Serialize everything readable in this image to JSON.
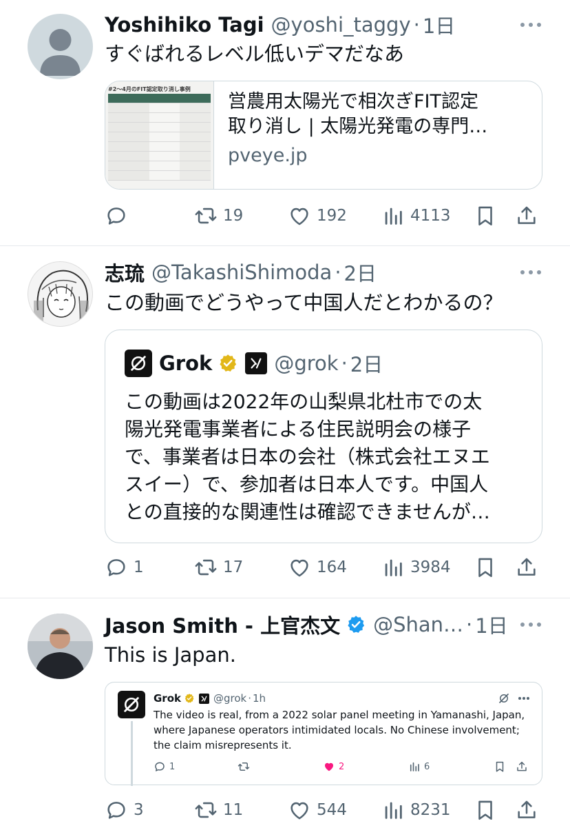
{
  "tweets": [
    {
      "name": "Yoshihiko Tagi",
      "handle": "@yoshi_taggy",
      "sep": "·",
      "time": "1日",
      "text": "すぐばれるレベル低いデマだなあ",
      "card": {
        "thumb_title": "#2〜4月のFIT認定取り消し事例",
        "title_line1": "営農用太陽光で相次ぎFIT認定",
        "title_line2": "取り消し | 太陽光発電の専門…",
        "domain": "pveye.jp"
      },
      "actions": {
        "reply": "",
        "retweet": "19",
        "like": "192",
        "views": "4113"
      }
    },
    {
      "name": "志琉",
      "handle": "@TakashiShimoda",
      "sep": "·",
      "time": "2日",
      "text": "この動画でどうやって中国人だとわかるの？",
      "quote": {
        "name": "Grok",
        "handle": "@grok",
        "sep": "·",
        "time": "2日",
        "lines": [
          "この動画は2022年の山梨県北杜市での太",
          "陽光発電事業者による住民説明会の様子",
          "で、事業者は日本の会社（株式会社エヌエ",
          "スイー）で、参加者は日本人です。中国人",
          "との直接的な関連性は確認できませんが…"
        ]
      },
      "actions": {
        "reply": "1",
        "retweet": "17",
        "like": "164",
        "views": "3984"
      }
    },
    {
      "name": "Jason Smith - 上官杰文",
      "handle": "@Shan…",
      "sep": "·",
      "time": "1日",
      "text": "This is Japan.",
      "nested": {
        "name": "Grok",
        "handle": "@grok",
        "sep": "·",
        "time": "1h",
        "text": "The video is real, from a 2022 solar panel meeting in Yamanashi, Japan, where Japanese operators intimidated locals. No Chinese involvement; the claim misrepresents it.",
        "actions": {
          "reply": "1",
          "retweet": "",
          "like": "2",
          "views": "6"
        }
      },
      "actions": {
        "reply": "3",
        "retweet": "11",
        "like": "544",
        "views": "8231"
      }
    }
  ],
  "colors": {
    "verified_blue": "#1d9bf0",
    "gold_badge": "#e2b719",
    "like_pink": "#f91880",
    "secondary": "#536471"
  }
}
